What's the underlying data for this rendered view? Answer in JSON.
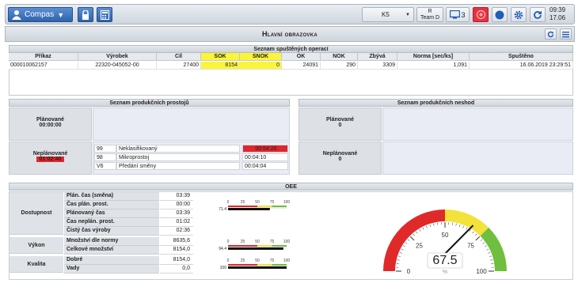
{
  "toolbar": {
    "user_label": "Compas",
    "station": "K5",
    "role_line1": "R",
    "role_line2": "Team D",
    "screens_count": "3",
    "time": "09:39",
    "date": "17.06"
  },
  "title": "Hlavní obrazovka",
  "operations": {
    "header": "Seznam spuštěných operací",
    "columns": [
      "Příkaz",
      "Výrobek",
      "Cíl",
      "SOK",
      "SNOK",
      "OK",
      "NOK",
      "Zbývá",
      "Norma [sec/ks]",
      "Spuštěno"
    ],
    "rows": [
      [
        "000010062157",
        "22320-045052-00",
        "27400",
        "8154",
        "0",
        "24091",
        "290",
        "3309",
        "1,091",
        "16.06.2019 23:29:51"
      ]
    ]
  },
  "downtime": {
    "header": "Seznam produkčních prostojů",
    "planned_label": "Plánované",
    "planned_time": "00:00:00",
    "unplanned_label": "Neplánované",
    "unplanned_time": "01:02:40",
    "items": [
      {
        "code": "99",
        "name": "Neklasifikovaný",
        "time": "00:54:26"
      },
      {
        "code": "98",
        "name": "Mikroprostoj",
        "time": "00:04:10"
      },
      {
        "code": "V6",
        "name": "Předání směny",
        "time": "00:04:04"
      }
    ]
  },
  "nonconform": {
    "header": "Seznam produkčních neshod",
    "planned_label": "Plánované",
    "planned_value": "0",
    "unplanned_label": "Neplánované",
    "unplanned_value": "0"
  },
  "oee": {
    "header": "OEE",
    "groups": [
      {
        "name": "Dostupnost",
        "rows": [
          {
            "label": "Plán. čas (směna)",
            "value": "03:39"
          },
          {
            "label": "Čas plán. prost.",
            "value": "00:00"
          },
          {
            "label": "Plánovaný čas",
            "value": "03:39"
          },
          {
            "label": "Čas neplán. prost.",
            "value": "01:02"
          },
          {
            "label": "Čistý čas výroby",
            "value": "02:36"
          }
        ]
      },
      {
        "name": "Výkon",
        "rows": [
          {
            "label": "Množství dle normy",
            "value": "8635,6"
          },
          {
            "label": "Celkové množství",
            "value": "8154,0"
          }
        ]
      },
      {
        "name": "Kvalita",
        "rows": [
          {
            "label": "Dobré",
            "value": "8154,0"
          },
          {
            "label": "Vady",
            "value": "0,0"
          }
        ]
      }
    ],
    "bars": [
      {
        "value_label": "71.4",
        "value": 71.4,
        "ticks": [
          "0",
          "25",
          "50",
          "75",
          "100"
        ]
      },
      {
        "value_label": "94.4",
        "value": 94.4,
        "ticks": [
          "0",
          "25",
          "50",
          "75",
          "100"
        ]
      },
      {
        "value_label": "100",
        "value": 100,
        "ticks": [
          "0",
          "25",
          "50",
          "75",
          "100"
        ]
      }
    ],
    "gauge": {
      "value": 67.5,
      "value_label": "67.5",
      "unit": "%",
      "ticks": [
        "0",
        "25",
        "50",
        "75",
        "100"
      ],
      "colors": {
        "red": "#e02a2a",
        "yellow": "#f3e23a",
        "green": "#6fbf3f"
      }
    }
  }
}
